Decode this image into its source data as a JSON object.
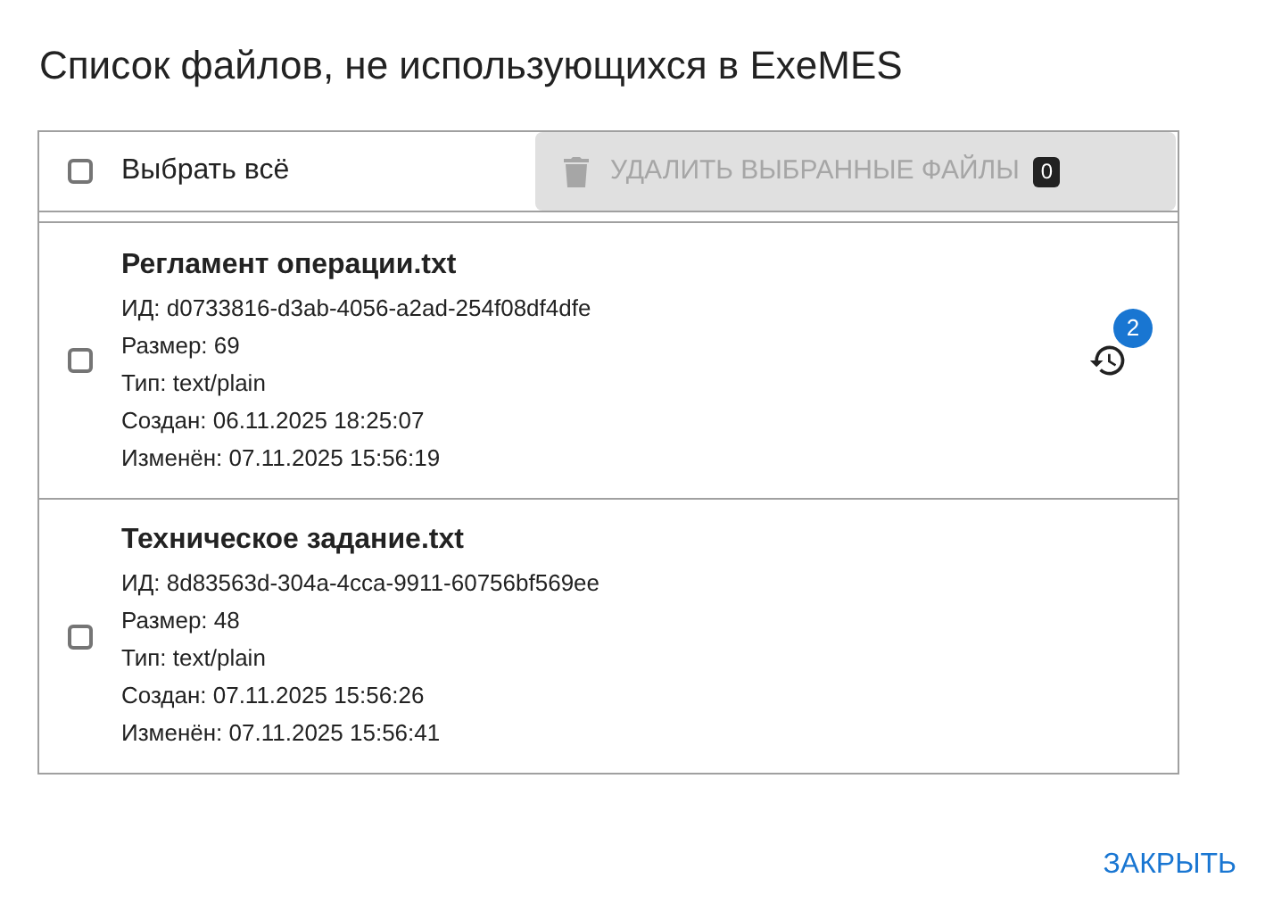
{
  "title": "Список файлов, не использующихся в ExeMES",
  "select_all": {
    "label": "Выбрать всё",
    "checked": false
  },
  "delete_button": {
    "label": "УДАЛИТЬ ВЫБРАННЫЕ ФАЙЛЫ",
    "count": "0",
    "disabled": true
  },
  "files": [
    {
      "name": "Регламент операции.txt",
      "checked": false,
      "details": [
        "ИД: d0733816-d3ab-4056-a2ad-254f08df4dfe",
        "Размер: 69",
        "Тип: text/plain",
        "Создан: 06.11.2025 18:25:07",
        "Изменён: 07.11.2025 15:56:19"
      ],
      "history_count": "2"
    },
    {
      "name": "Техническое задание.txt",
      "checked": false,
      "details": [
        "ИД: 8d83563d-304a-4cca-9911-60756bf569ee",
        "Размер: 48",
        "Тип: text/plain",
        "Создан: 07.11.2025 15:56:26",
        "Изменён: 07.11.2025 15:56:41"
      ]
    }
  ],
  "close_button": "ЗАКРЫТЬ"
}
